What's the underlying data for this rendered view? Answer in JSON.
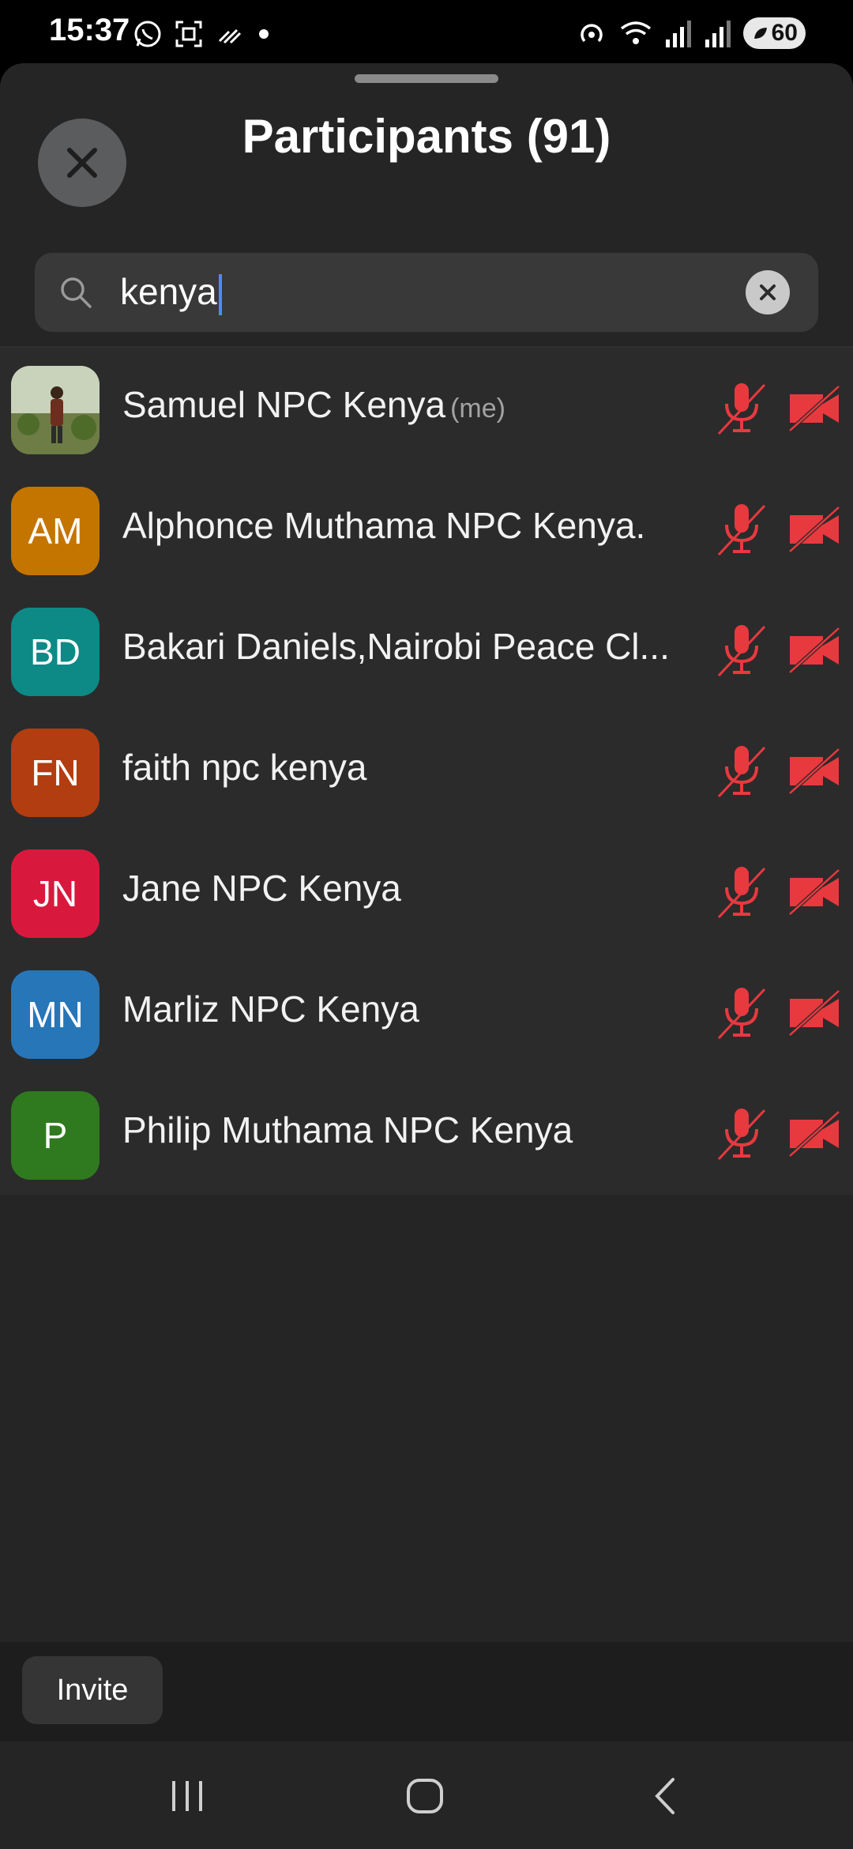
{
  "status_bar": {
    "time": "15:37",
    "left_icons": [
      "whatsapp-icon",
      "screenshot-icon",
      "data-saver-icon",
      "dot-icon"
    ],
    "right_icons": [
      "hotspot-icon",
      "wifi-icon",
      "signal-icon",
      "signal-icon"
    ],
    "battery": "60"
  },
  "sheet": {
    "title": "Participants (91)",
    "close_icon": "close-icon"
  },
  "search": {
    "value": "kenya",
    "icon": "search-icon",
    "clear_icon": "clear-icon"
  },
  "participants": [
    {
      "name": "Samuel NPC Kenya",
      "tag": "(me)",
      "initials": "",
      "avatar_color": "#7b8a55",
      "photo": true
    },
    {
      "name": "Alphonce Muthama NPC Kenya.",
      "tag": "",
      "initials": "AM",
      "avatar_color": "#c47500"
    },
    {
      "name": "Bakari Daniels,Nairobi Peace Cl...",
      "tag": "",
      "initials": "BD",
      "avatar_color": "#0d8a86"
    },
    {
      "name": "faith npc kenya",
      "tag": "",
      "initials": "FN",
      "avatar_color": "#b23d10"
    },
    {
      "name": "Jane NPC Kenya",
      "tag": "",
      "initials": "JN",
      "avatar_color": "#d9183d"
    },
    {
      "name": "Marliz NPC Kenya",
      "tag": "",
      "initials": "MN",
      "avatar_color": "#2776b8"
    },
    {
      "name": "Philip Muthama NPC Kenya",
      "tag": "",
      "initials": "P",
      "avatar_color": "#2f7a1f"
    }
  ],
  "muted_color": "#e8393f",
  "bottom": {
    "invite_label": "Invite"
  },
  "nav": [
    "recents-icon",
    "home-icon",
    "back-icon"
  ]
}
